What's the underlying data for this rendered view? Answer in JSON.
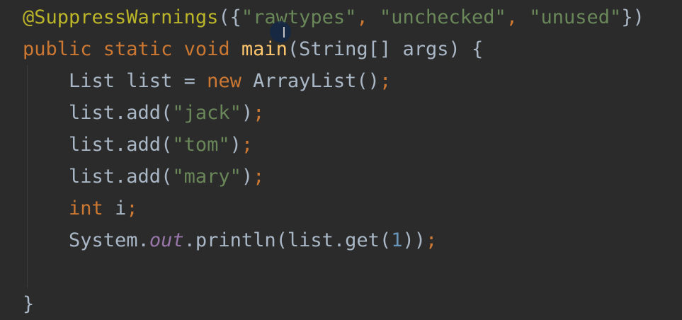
{
  "lines": [
    {
      "tokens": [
        {
          "type": "annotation",
          "text": "@SuppressWarnings"
        },
        {
          "type": "plain",
          "text": "({"
        },
        {
          "type": "string",
          "text": "\"rawtypes\""
        },
        {
          "type": "keyword",
          "text": ", "
        },
        {
          "type": "string",
          "text": "\"unchecked\""
        },
        {
          "type": "keyword",
          "text": ", "
        },
        {
          "type": "string",
          "text": "\"unused\""
        },
        {
          "type": "plain",
          "text": "})"
        }
      ]
    },
    {
      "tokens": [
        {
          "type": "keyword",
          "text": "public static void "
        },
        {
          "type": "method-decl",
          "text": "main"
        },
        {
          "type": "plain",
          "text": "(String[] args) {"
        }
      ]
    },
    {
      "tokens": [
        {
          "type": "plain",
          "text": "    List list = "
        },
        {
          "type": "keyword",
          "text": "new "
        },
        {
          "type": "plain",
          "text": "ArrayList()"
        },
        {
          "type": "keyword",
          "text": ";"
        }
      ]
    },
    {
      "tokens": [
        {
          "type": "plain",
          "text": "    list.add("
        },
        {
          "type": "string",
          "text": "\"jack\""
        },
        {
          "type": "plain",
          "text": ")"
        },
        {
          "type": "keyword",
          "text": ";"
        }
      ]
    },
    {
      "tokens": [
        {
          "type": "plain",
          "text": "    list.add("
        },
        {
          "type": "string",
          "text": "\"tom\""
        },
        {
          "type": "plain",
          "text": ")"
        },
        {
          "type": "keyword",
          "text": ";"
        }
      ]
    },
    {
      "tokens": [
        {
          "type": "plain",
          "text": "    list.add("
        },
        {
          "type": "string",
          "text": "\"mary\""
        },
        {
          "type": "plain",
          "text": ")"
        },
        {
          "type": "keyword",
          "text": ";"
        }
      ]
    },
    {
      "tokens": [
        {
          "type": "plain",
          "text": "    "
        },
        {
          "type": "keyword",
          "text": "int "
        },
        {
          "type": "plain",
          "text": "i"
        },
        {
          "type": "keyword",
          "text": ";"
        }
      ]
    },
    {
      "tokens": [
        {
          "type": "plain",
          "text": "    System."
        },
        {
          "type": "static-field",
          "text": "out"
        },
        {
          "type": "plain",
          "text": ".println(list.get("
        },
        {
          "type": "number",
          "text": "1"
        },
        {
          "type": "plain",
          "text": "))"
        },
        {
          "type": "keyword",
          "text": ";"
        }
      ]
    },
    {
      "tokens": [
        {
          "type": "plain",
          "text": ""
        }
      ]
    },
    {
      "tokens": [
        {
          "type": "plain",
          "text": "}"
        }
      ]
    }
  ],
  "mouse_cursor_glyph": "I",
  "colors": {
    "background": "#2b2b2b",
    "plain": "#a9b7c6",
    "keyword": "#cc7832",
    "annotation": "#bbb529",
    "method_declaration": "#ffc66d",
    "string": "#6a8759",
    "static_field": "#9876aa",
    "number": "#6897bb"
  }
}
